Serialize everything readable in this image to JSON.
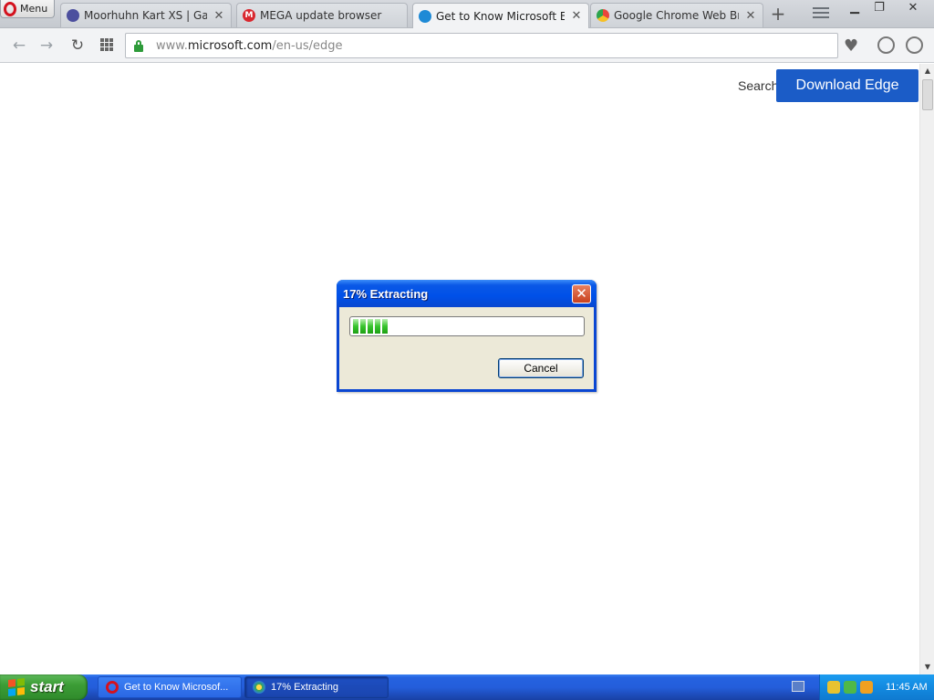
{
  "browser": {
    "menu_label": "Menu",
    "tabs": [
      {
        "label": "Moorhuhn Kart XS | GamingF",
        "favicon_color": "#4c4f9e",
        "active": false
      },
      {
        "label": "MEGA update browser",
        "favicon_color": "#d9272e",
        "favicon_text": "M",
        "active": false
      },
      {
        "label": "Get to Know Microsoft Edge",
        "favicon_color": "#1e8ad6",
        "active": true
      },
      {
        "label": "Google Chrome Web Browser",
        "favicon_color": "#e8453c",
        "active": false
      }
    ],
    "close_glyph": "✕",
    "new_tab_glyph": "+",
    "url_prefix": "www.",
    "url_host": "microsoft.com",
    "url_path": "/en-us/edge"
  },
  "page": {
    "search_label": "Search",
    "download_label": "Download Edge",
    "accent": "#1b5cc7"
  },
  "dialog": {
    "title": "17% Extracting",
    "close_glyph": "✕",
    "progress_percent": 17,
    "cancel_label": "Cancel"
  },
  "taskbar": {
    "start_label": "start",
    "tasks": [
      {
        "label": "Get to Know Microsof..."
      },
      {
        "label": "17% Extracting"
      }
    ],
    "clock": "11:45 AM"
  }
}
